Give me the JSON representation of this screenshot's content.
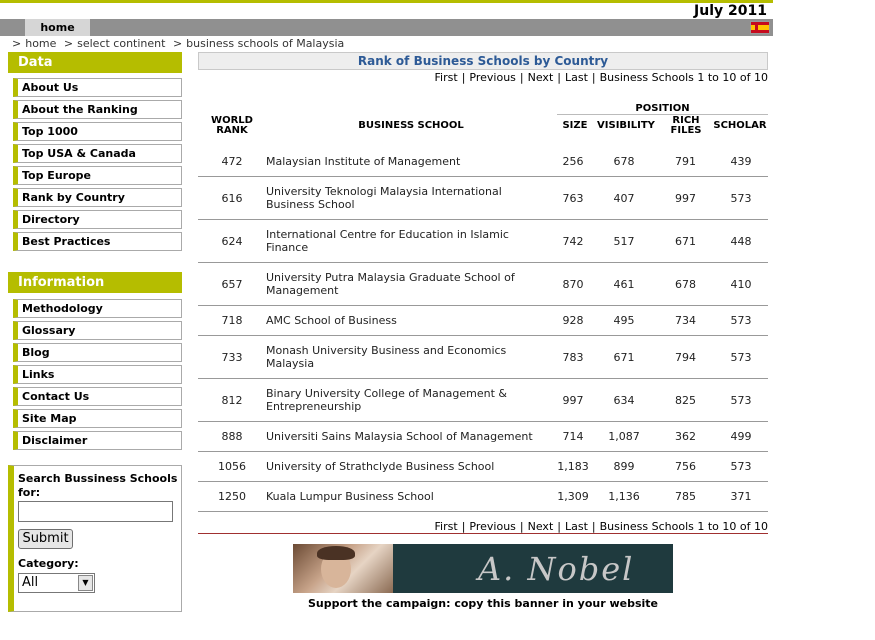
{
  "header": {
    "date": "July 2011",
    "home_tab": "home"
  },
  "breadcrumb": [
    "home",
    "select continent",
    "business schools of Malaysia"
  ],
  "sidebar": {
    "data_heading": "Data",
    "data_items": [
      "About Us",
      "About the Ranking",
      "Top 1000",
      "Top USA & Canada",
      "Top Europe",
      "Rank by Country",
      "Directory",
      "Best Practices"
    ],
    "info_heading": "Information",
    "info_items": [
      "Methodology",
      "Glossary",
      "Blog",
      "Links",
      "Contact Us",
      "Site Map",
      "Disclaimer"
    ],
    "search": {
      "label": "Search Bussiness Schools for:",
      "input_value": "",
      "submit_label": "Submit",
      "category_label": "Category:",
      "category_selected": "All"
    }
  },
  "table": {
    "title": "Rank of Business Schools by Country",
    "pager": {
      "first": "First",
      "previous": "Previous",
      "next": "Next",
      "last": "Last",
      "summary": "Business Schools 1 to 10 of 10"
    },
    "headers": {
      "world_rank": "WORLD RANK",
      "business_school": "BUSINESS SCHOOL",
      "position": "POSITION",
      "size": "SIZE",
      "visibility": "VISIBILITY",
      "rich_files": "RICH FILES",
      "scholar": "SCHOLAR"
    },
    "rows": [
      {
        "rank": "472",
        "name": "Malaysian Institute of Management",
        "size": "256",
        "visibility": "678",
        "rich": "791",
        "scholar": "439"
      },
      {
        "rank": "616",
        "name": "University Teknologi Malaysia International Business School",
        "size": "763",
        "visibility": "407",
        "rich": "997",
        "scholar": "573"
      },
      {
        "rank": "624",
        "name": "International Centre for Education in Islamic Finance",
        "size": "742",
        "visibility": "517",
        "rich": "671",
        "scholar": "448"
      },
      {
        "rank": "657",
        "name": "University Putra Malaysia Graduate School of Management",
        "size": "870",
        "visibility": "461",
        "rich": "678",
        "scholar": "410"
      },
      {
        "rank": "718",
        "name": "AMC School of Business",
        "size": "928",
        "visibility": "495",
        "rich": "734",
        "scholar": "573"
      },
      {
        "rank": "733",
        "name": "Monash University Business and Economics Malaysia",
        "size": "783",
        "visibility": "671",
        "rich": "794",
        "scholar": "573"
      },
      {
        "rank": "812",
        "name": "Binary University College of Management & Entrepreneurship",
        "size": "997",
        "visibility": "634",
        "rich": "825",
        "scholar": "573"
      },
      {
        "rank": "888",
        "name": "Universiti Sains Malaysia School of Management",
        "size": "714",
        "visibility": "1,087",
        "rich": "362",
        "scholar": "499"
      },
      {
        "rank": "1056",
        "name": "University of Strathclyde Business School",
        "size": "1,183",
        "visibility": "899",
        "rich": "756",
        "scholar": "573"
      },
      {
        "rank": "1250",
        "name": "Kuala Lumpur Business School",
        "size": "1,309",
        "visibility": "1,136",
        "rich": "785",
        "scholar": "371"
      }
    ]
  },
  "banner": {
    "signature": "A. Nobel",
    "caption": "Support the campaign: copy this banner in your website"
  }
}
